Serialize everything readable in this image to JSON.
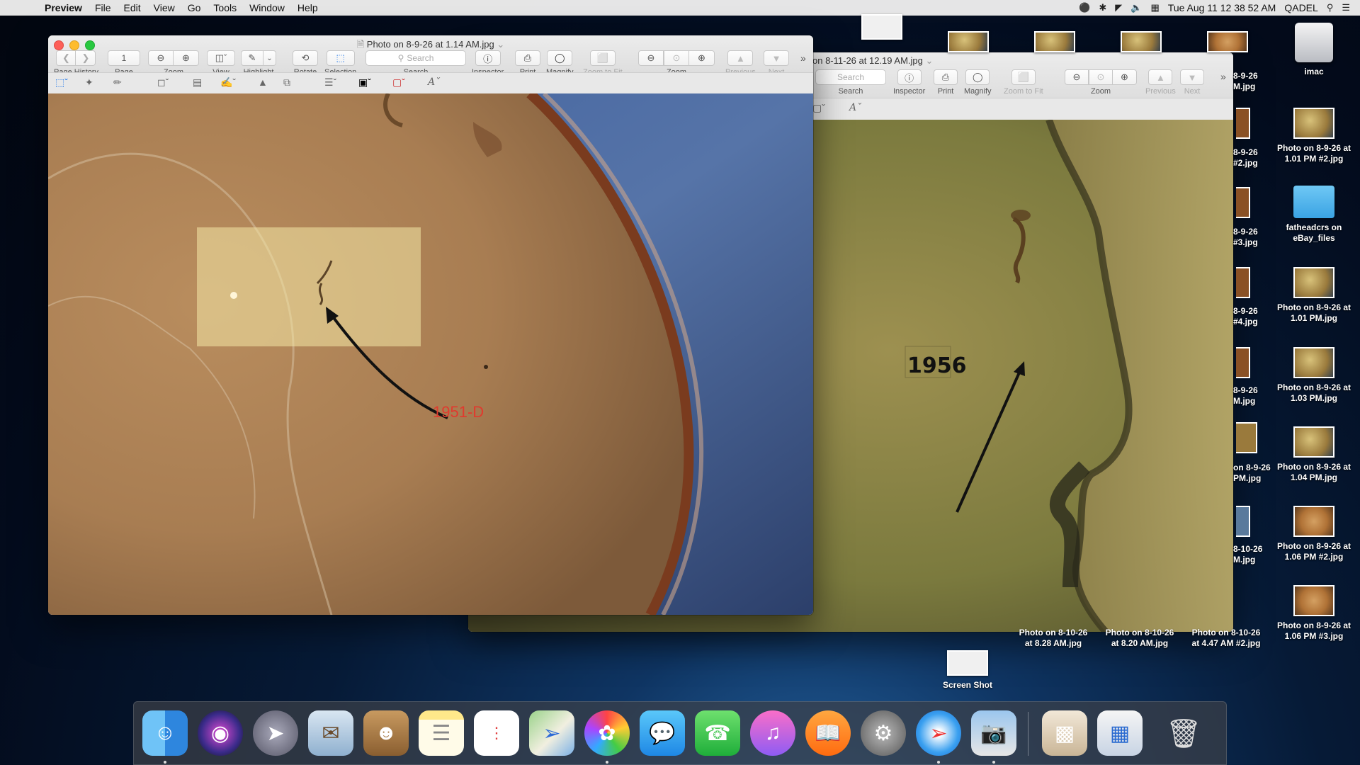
{
  "menubar": {
    "app": "Preview",
    "items": [
      "File",
      "Edit",
      "View",
      "Go",
      "Tools",
      "Window",
      "Help"
    ],
    "clock": "Tue Aug 11  12 38 52 AM",
    "user": "QADEL"
  },
  "front_window": {
    "title": "Photo on 8-9-26 at 1.14 AM.jpg",
    "page_value": "1",
    "search_placeholder": "Search",
    "toolbar_labels": {
      "page_history": "Page History",
      "page": "Page",
      "zoom": "Zoom",
      "view": "View",
      "highlight": "Highlight",
      "rotate": "Rotate",
      "selection": "Selection",
      "search": "Search",
      "inspector": "Inspector",
      "print": "Print",
      "magnify": "Magnify",
      "zoom_to_fit": "Zoom to Fit",
      "zoom2": "Zoom",
      "previous": "Previous",
      "next": "Next"
    },
    "annotation_text": "1951-D"
  },
  "back_window": {
    "title": "on 8-11-26 at 12.19 AM.jpg",
    "search_placeholder": "Search",
    "toolbar_labels": {
      "search": "Search",
      "inspector": "Inspector",
      "print": "Print",
      "magnify": "Magnify",
      "zoom_to_fit": "Zoom to Fit",
      "zoom": "Zoom",
      "previous": "Previous",
      "next": "Next"
    },
    "annotation_text": "1956"
  },
  "desktop": {
    "right_column": [
      {
        "label": "imac",
        "kind": "drive"
      },
      {
        "label": "Photo on 8-9-26 at 1.01 PM #2.jpg",
        "kind": "photo"
      },
      {
        "label": "fatheadcrs on eBay_files",
        "kind": "folder"
      },
      {
        "label": "Photo on 8-9-26 at 1.01 PM.jpg",
        "kind": "photo"
      },
      {
        "label": "Photo on 8-9-26 at 1.03 PM.jpg",
        "kind": "photo"
      },
      {
        "label": "Photo on 8-9-26 at 1.04 PM.jpg",
        "kind": "photo"
      },
      {
        "label": "Photo on 8-9-26 at 1.06 PM #2.jpg",
        "kind": "photo"
      },
      {
        "label": "Photo on 8-9-26 at 1.06 PM #3.jpg",
        "kind": "photo"
      }
    ],
    "partial_column": [
      {
        "label": "8-9-26 M.jpg"
      },
      {
        "label": "8-9-26 #2.jpg"
      },
      {
        "label": "8-9-26 #3.jpg"
      },
      {
        "label": "8-9-26 #4.jpg"
      },
      {
        "label": "8-9-26 M.jpg"
      },
      {
        "label": "on 8-9-26 PM.jpg"
      },
      {
        "label": "8-10-26 M.jpg"
      }
    ],
    "bottom_row": [
      {
        "label": "Photo on 8-10-26 at 8.28 AM.jpg"
      },
      {
        "label": "Photo on 8-10-26 at 8.20 AM.jpg"
      },
      {
        "label": "Photo on 8-10-26 at 4.47 AM #2.jpg"
      }
    ],
    "screenshot": {
      "label": "Screen Shot"
    }
  },
  "dock": {
    "apps": [
      "Finder",
      "Siri",
      "Launchpad",
      "Mail",
      "Contacts",
      "Notes",
      "Reminders",
      "Maps",
      "Photos",
      "Messages",
      "FaceTime",
      "iTunes",
      "iBooks",
      "System Preferences",
      "Safari",
      "Preview",
      "Downloads",
      "Documents",
      "Trash"
    ]
  }
}
